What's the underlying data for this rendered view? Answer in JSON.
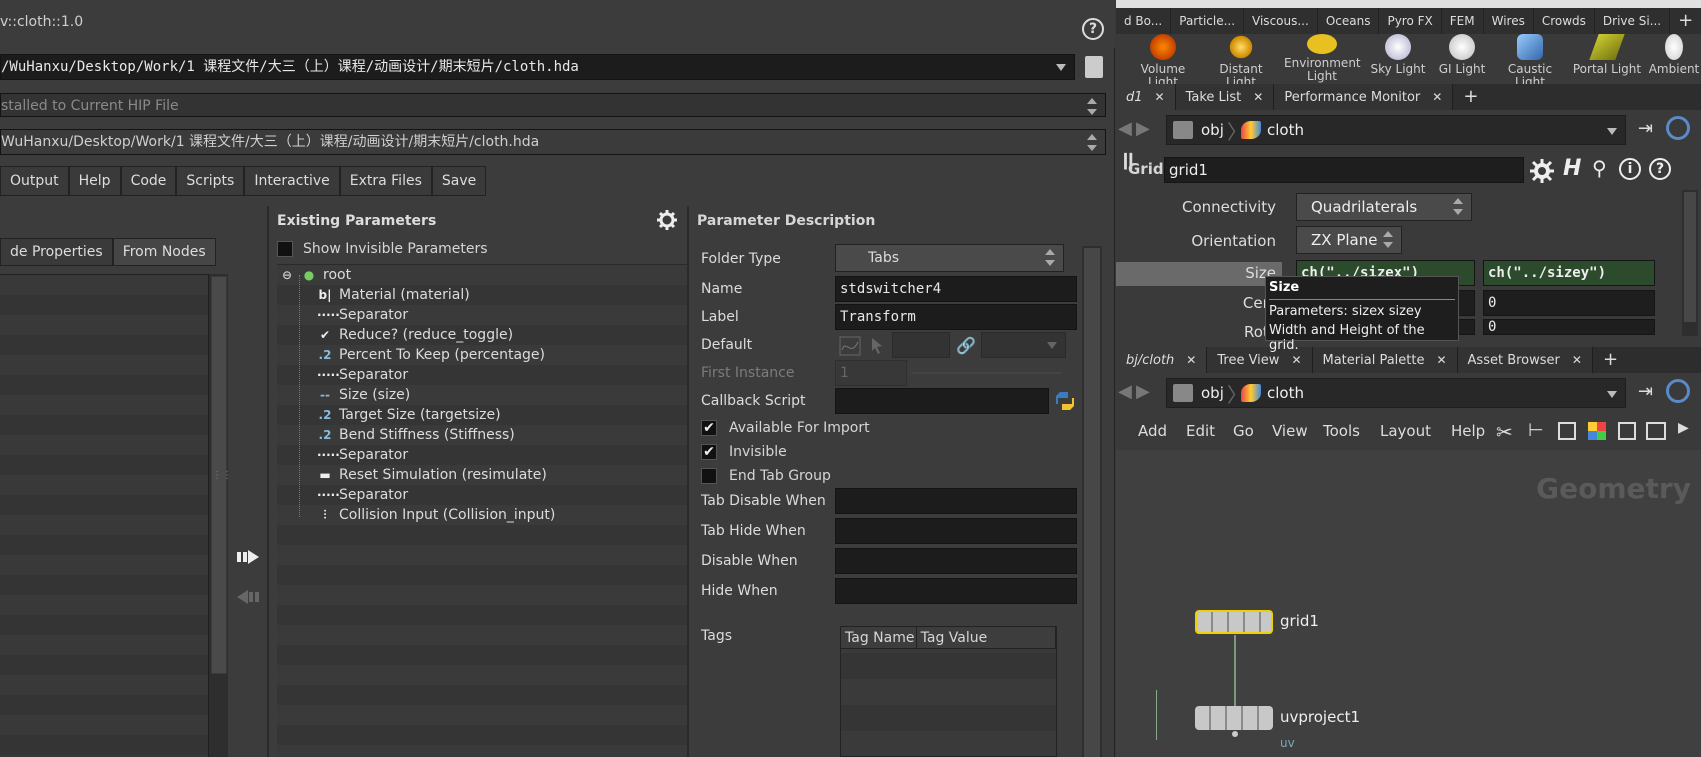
{
  "dialog": {
    "title": "v::cloth::1.0",
    "library_path": "/WuHanxu/Desktop/Work/1 课程文件/大三（上）课程/动画设计/期末短片/cloth.hda",
    "save_to_label": "stalled to Current HIP File",
    "source_path": "WuHanxu/Desktop/Work/1 课程文件/大三（上）课程/动画设计/期末短片/cloth.hda",
    "tabs": [
      "Output",
      "Help",
      "Code",
      "Scripts",
      "Interactive",
      "Extra Files",
      "Save"
    ],
    "left_buttons": [
      "de Properties",
      "From Nodes"
    ]
  },
  "existing_params": {
    "title": "Existing Parameters",
    "show_invisible_label": "Show Invisible Parameters",
    "tree": [
      {
        "label": "root",
        "icon": "globe-icon"
      },
      {
        "label": "Material (material)",
        "icon": "string-icon"
      },
      {
        "label": "Separator",
        "icon": "separator-icon"
      },
      {
        "label": "Reduce? (reduce_toggle)",
        "icon": "toggle-icon"
      },
      {
        "label": "Percent To Keep (percentage)",
        "icon": "float-icon"
      },
      {
        "label": "Separator",
        "icon": "separator-icon"
      },
      {
        "label": "Size (size)",
        "icon": "vector-icon"
      },
      {
        "label": "Target Size (targetsize)",
        "icon": "float-icon"
      },
      {
        "label": "Bend Stiffness (Stiffness)",
        "icon": "float-icon"
      },
      {
        "label": "Separator",
        "icon": "separator-icon"
      },
      {
        "label": "Reset Simulation (resimulate)",
        "icon": "button-icon"
      },
      {
        "label": "Separator",
        "icon": "separator-icon"
      },
      {
        "label": "Collision Input (Collision_input)",
        "icon": "input-icon"
      }
    ]
  },
  "param_desc": {
    "title": "Parameter Description",
    "folder_type_label": "Folder Type",
    "folder_type_value": "Tabs",
    "name_label": "Name",
    "name_value": "stdswitcher4",
    "label_label": "Label",
    "label_value": "Transform",
    "default_label": "Default",
    "first_instance_label": "First Instance",
    "first_instance_value": "1",
    "callback_label": "Callback Script",
    "available_label": "Available For Import",
    "invisible_label": "Invisible",
    "end_tab_label": "End Tab Group",
    "tab_disable_label": "Tab Disable When",
    "tab_hide_label": "Tab Hide When",
    "disable_label": "Disable When",
    "hide_label": "Hide When",
    "tags_label": "Tags",
    "tag_cols": [
      "Tag Name",
      "Tag Value"
    ]
  },
  "shelf": {
    "tabs": [
      "d Bo...",
      "Particle...",
      "Viscous...",
      "Oceans",
      "Pyro FX",
      "FEM",
      "Wires",
      "Crowds",
      "Drive Si..."
    ],
    "tools": [
      "Volume Light",
      "Distant Light",
      "Environment Light",
      "Sky Light",
      "GI Light",
      "Caustic Light",
      "Portal Light",
      "Ambient"
    ]
  },
  "params_pane": {
    "tabs": [
      "d1",
      "Take List",
      "Performance Monitor"
    ],
    "path": [
      "obj",
      "cloth"
    ],
    "node_type": "Grid",
    "node_name": "grid1",
    "connectivity_label": "Connectivity",
    "connectivity_value": "Quadrilaterals",
    "orientation_label": "Orientation",
    "orientation_value": "ZX Plane",
    "size_label": "Size",
    "size_x": "ch(\"../sizex\")",
    "size_y": "ch(\"../sizey\")",
    "center_label": "Cent",
    "center_z": "0",
    "rotate_label": "Rota",
    "rotate_z": "0",
    "tooltip_title": "Size",
    "tooltip_line1": "Parameters: sizex sizey",
    "tooltip_line2": "Width and Height of the grid."
  },
  "network_pane": {
    "tabs": [
      "bj/cloth",
      "Tree View",
      "Material Palette",
      "Asset Browser"
    ],
    "path": [
      "obj",
      "cloth"
    ],
    "menu": [
      "Add",
      "Edit",
      "Go",
      "View",
      "Tools",
      "Layout",
      "Help"
    ],
    "context_title": "Geometry",
    "nodes": [
      {
        "name": "grid1"
      },
      {
        "name": "uvproject1",
        "sub": "uv"
      }
    ]
  }
}
